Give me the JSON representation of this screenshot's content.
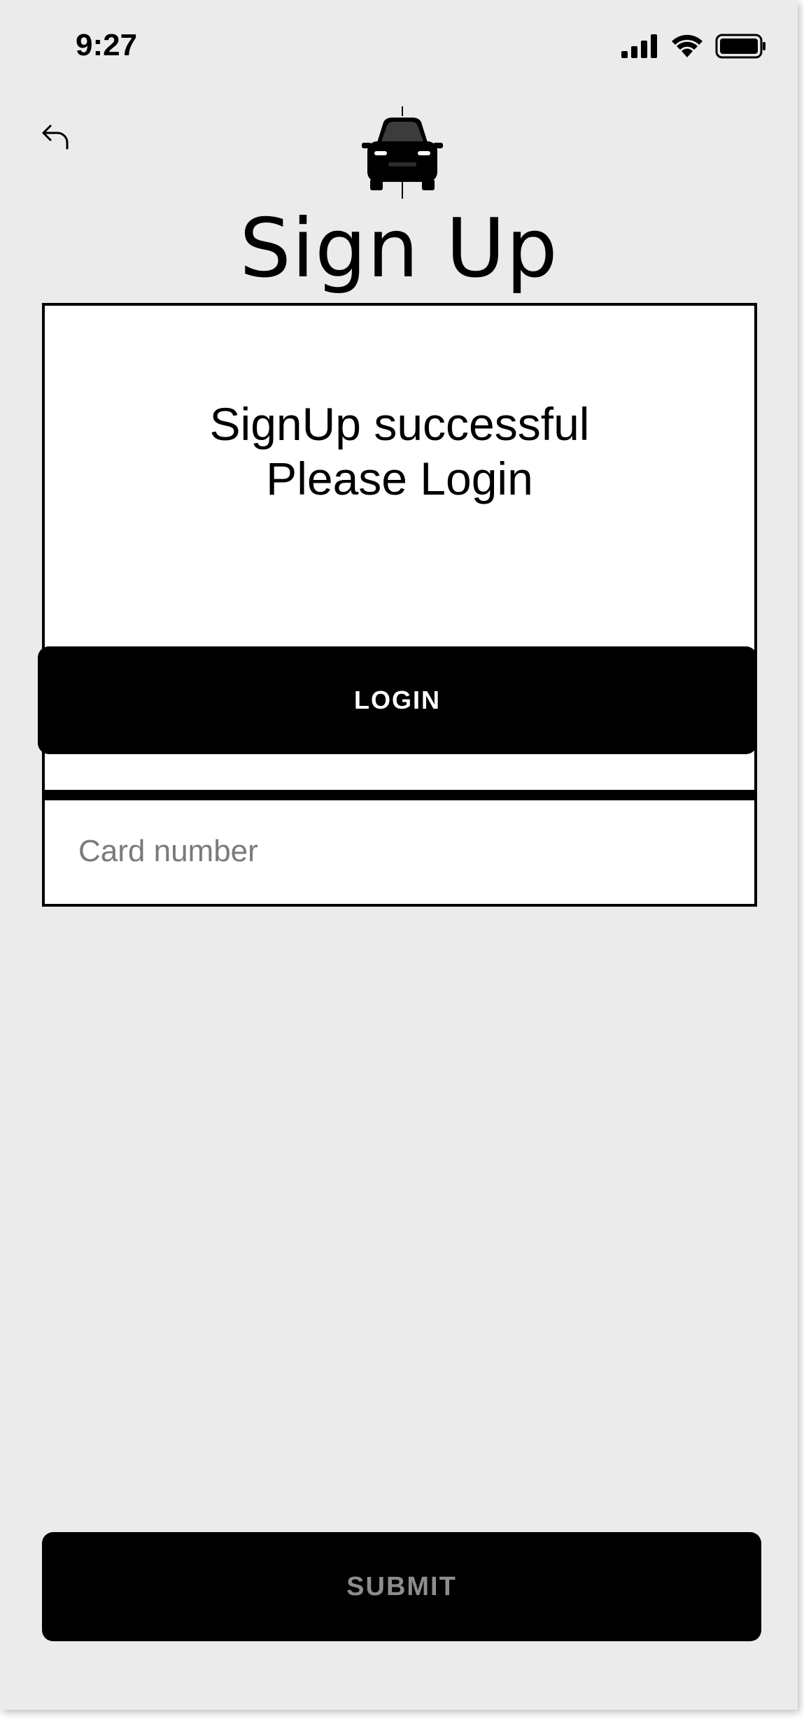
{
  "status_bar": {
    "time": "9:27",
    "icons": [
      "cellular-signal-icon",
      "wifi-icon",
      "battery-icon"
    ]
  },
  "header": {
    "back_icon": "back-arrow-icon",
    "logo_icon": "car-icon",
    "title": "Sign Up"
  },
  "dialog": {
    "message_line1": "SignUp successful",
    "message_line2": "Please Login",
    "button_label": "LOGIN"
  },
  "form": {
    "card_number": {
      "value": "",
      "placeholder": "Card number"
    }
  },
  "footer": {
    "submit_label": "SUBMIT"
  },
  "colors": {
    "background": "#ebebeb",
    "button": "#000000",
    "button_text_active": "#ffffff",
    "button_text_disabled": "#8d8d8d"
  }
}
